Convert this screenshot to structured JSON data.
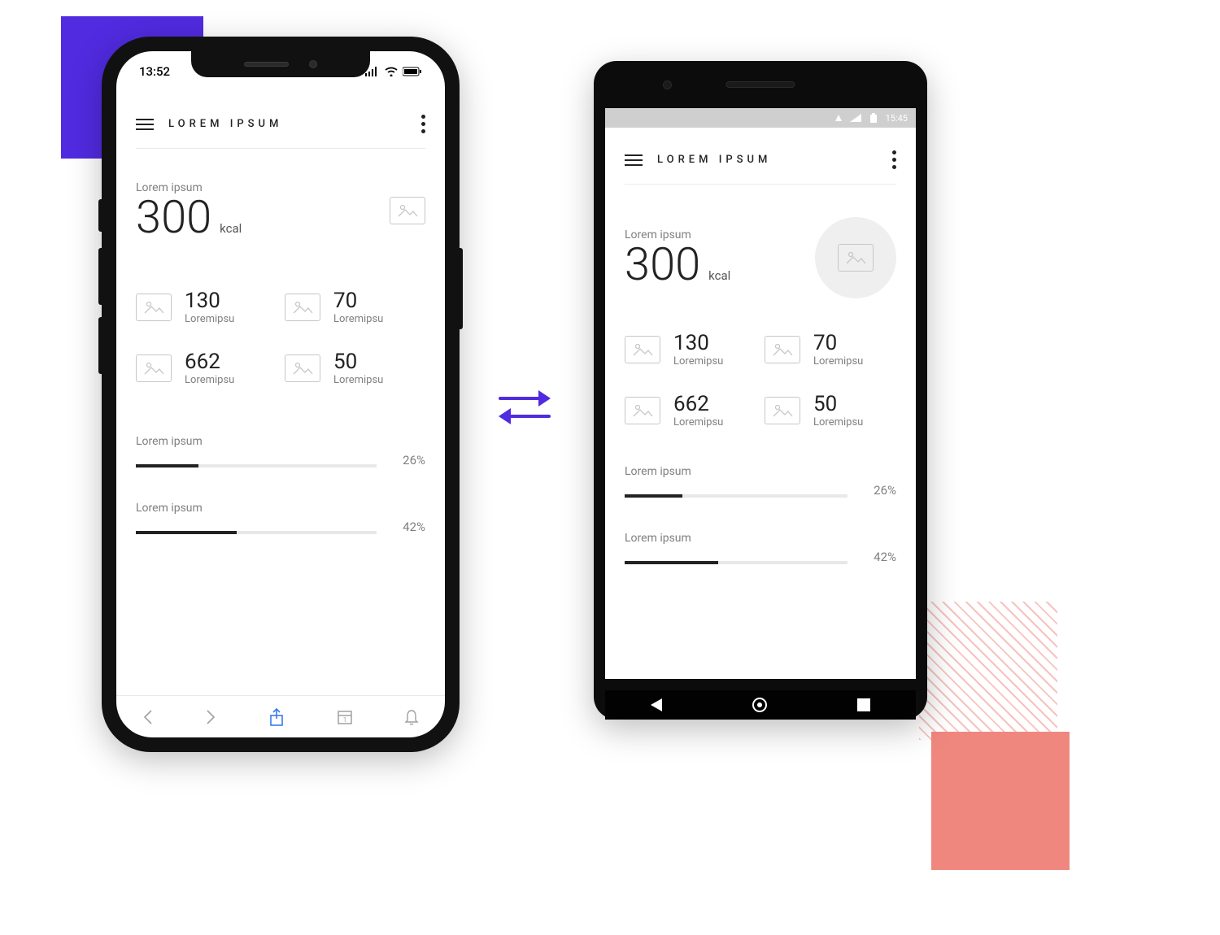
{
  "app_title": "LOREM IPSUM",
  "iphone": {
    "time": "13:52"
  },
  "android": {
    "time": "15:45"
  },
  "hero": {
    "label": "Lorem ipsum",
    "value": "300",
    "unit": "kcal"
  },
  "stats": [
    {
      "value": "130",
      "label": "Loremipsu"
    },
    {
      "value": "70",
      "label": "Loremipsu"
    },
    {
      "value": "662",
      "label": "Loremipsu"
    },
    {
      "value": "50",
      "label": "Loremipsu"
    }
  ],
  "progress": [
    {
      "label": "Lorem ipsum",
      "pct": "26%",
      "fill": 26
    },
    {
      "label": "Lorem ipsum",
      "pct": "42%",
      "fill": 42
    }
  ],
  "ios_bottombar_day": "1"
}
